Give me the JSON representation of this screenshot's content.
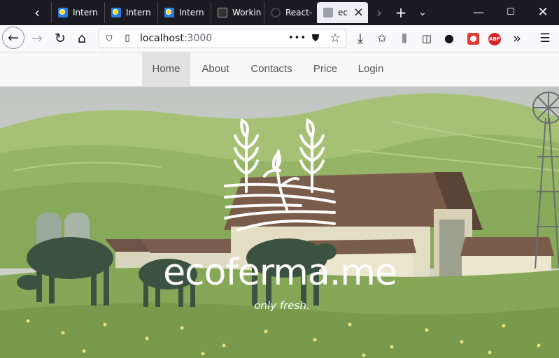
{
  "browser": {
    "tabs": [
      {
        "title": "Intern",
        "favicon": "blue-monitor-icon"
      },
      {
        "title": "Intern",
        "favicon": "blue-monitor-icon"
      },
      {
        "title": "Intern",
        "favicon": "blue-monitor-icon"
      },
      {
        "title": "Workin",
        "favicon": "dark-badge-icon"
      },
      {
        "title": "React-",
        "favicon": "react-ring-icon"
      },
      {
        "title": "ec",
        "favicon": "gray-page-icon",
        "active": true
      }
    ],
    "url_host": "localhost",
    "url_port": ":3000",
    "extension_abp": "ABP"
  },
  "site": {
    "nav": [
      {
        "label": "Home",
        "active": true
      },
      {
        "label": "About"
      },
      {
        "label": "Contacts"
      },
      {
        "label": "Price"
      },
      {
        "label": "Login"
      }
    ],
    "brand": "ecoferma.me",
    "tagline": "only fresh."
  },
  "colors": {
    "browser_chrome": "#1c1b22",
    "sky": "#b9bcbd",
    "grass": "#87ab5a",
    "barn_roof": "#7a5a48",
    "white_text": "#ffffff"
  }
}
